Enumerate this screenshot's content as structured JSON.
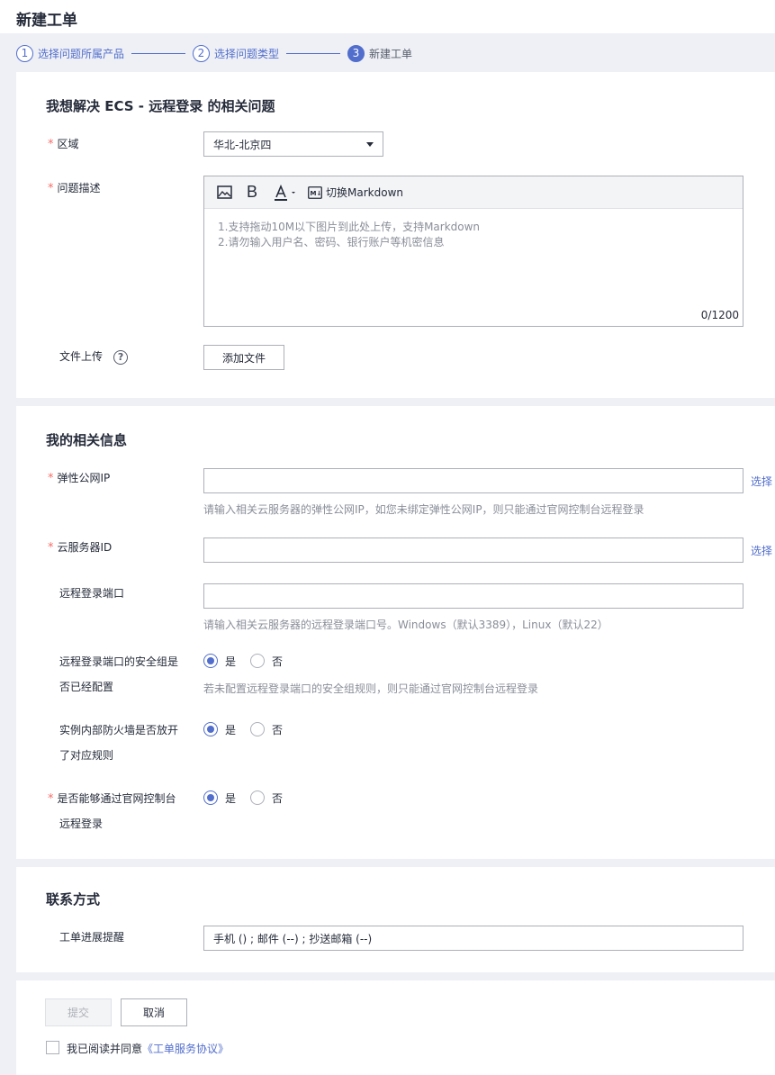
{
  "page": {
    "title": "新建工单"
  },
  "steps": [
    {
      "num": "1",
      "label": "选择问题所属产品"
    },
    {
      "num": "2",
      "label": "选择问题类型"
    },
    {
      "num": "3",
      "label": "新建工单"
    }
  ],
  "problem": {
    "title": "我想解决 ECS - 远程登录 的相关问题",
    "region_label": "区域",
    "region_value": "华北-北京四",
    "desc_label": "问题描述",
    "markdown_toggle": "切换Markdown",
    "placeholder": "1.支持拖动10M以下图片到此处上传，支持Markdown\n2.请勿输入用户名、密码、银行账户等机密信息",
    "counter": "0/1200",
    "upload_label": "文件上传",
    "upload_help": "?",
    "add_file": "添加文件"
  },
  "info": {
    "title": "我的相关信息",
    "eip_label": "弹性公网IP",
    "eip_select": "选择",
    "eip_hint": "请输入相关云服务器的弹性公网IP，如您未绑定弹性公网IP，则只能通过官网控制台远程登录",
    "server_label": "云服务器ID",
    "server_select": "选择",
    "port_label": "远程登录端口",
    "port_hint": "请输入相关云服务器的远程登录端口号。Windows（默认3389），Linux（默认22）",
    "sg_label_1": "远程登录端口的安全组是",
    "sg_label_2": "否已经配置",
    "sg_hint": "若未配置远程登录端口的安全组规则，则只能通过官网控制台远程登录",
    "fw_label_1": "实例内部防火墙是否放开",
    "fw_label_2": "了对应规则",
    "console_label_1": "是否能够通过官网控制台",
    "console_label_2": "远程登录",
    "yes": "是",
    "no": "否"
  },
  "contact": {
    "title": "联系方式",
    "progress_label": "工单进展提醒",
    "progress_value": "手机 () ; 邮件 (--) ; 抄送邮箱 (--)"
  },
  "footer": {
    "submit": "提交",
    "cancel": "取消",
    "agree_text": "我已阅读并同意",
    "agree_link": "《工单服务协议》"
  },
  "colors": {
    "accent": "#526ecc",
    "required": "#f66f6a",
    "hint": "#8a8e99"
  }
}
